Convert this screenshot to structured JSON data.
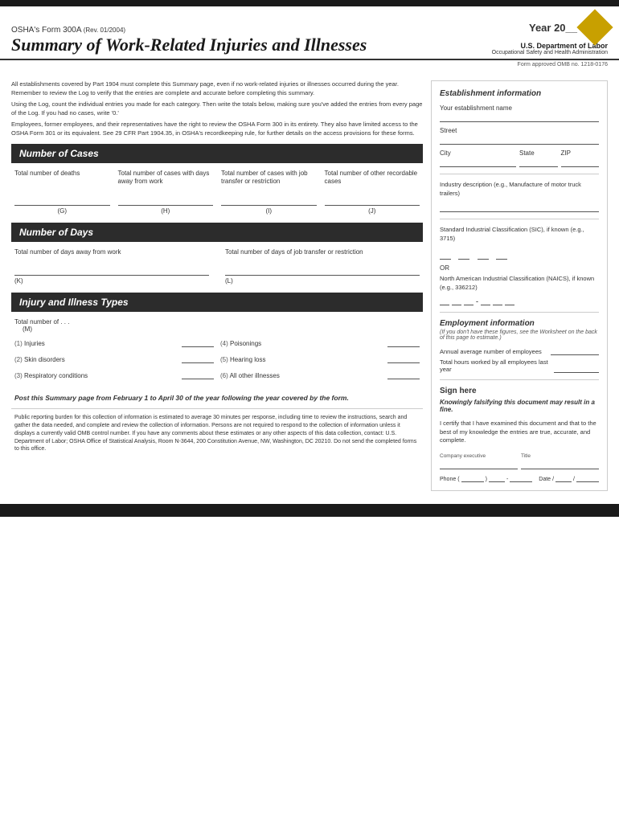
{
  "header": {
    "form_name": "OSHA's Form 300A",
    "form_rev": "(Rev. 01/2004)",
    "form_title": "Summary of Work-Related Injuries and Illnesses",
    "year_label": "Year 20",
    "year_blank": "__",
    "dept_name": "U.S. Department of Labor",
    "dept_sub": "Occupational Safety and Health Administration",
    "omb_text": "Form approved OMB no. 1218-0176"
  },
  "intro": {
    "para1": "All establishments covered by Part 1904 must complete this Summary page, even if no work-related injuries or illnesses occurred during the year. Remember to review the Log to verify that the entries are complete and accurate before completing this summary.",
    "para2": "Using the Log, count the individual entries you made for each category. Then write the totals below, making sure you've added the entries from every page of the Log. If you had no cases, write '0.'",
    "para3": "Employees, former employees, and their representatives have the right to review the OSHA Form 300 in its entirety. They also have limited access to the OSHA Form 301 or its equivalent. See 29 CFR Part 1904.35, in OSHA's recordkeeping rule, for further details on the access provisions for these forms."
  },
  "number_of_cases": {
    "section_title": "Number of Cases",
    "col1_label": "Total number of deaths",
    "col2_label": "Total number of cases with days away from work",
    "col3_label": "Total number of cases with job transfer or restriction",
    "col4_label": "Total number of other recordable cases",
    "code1": "(G)",
    "code2": "(H)",
    "code3": "(I)",
    "code4": "(J)"
  },
  "number_of_days": {
    "section_title": "Number of Days",
    "col1_label": "Total number of days away from work",
    "col2_label": "Total number of days of job transfer or restriction",
    "code1": "(K)",
    "code2": "(L)"
  },
  "injury_illness": {
    "section_title": "Injury and Illness Types",
    "total_label": "Total number of . . .",
    "code_m": "(M)",
    "items_left": [
      {
        "code": "(1)",
        "label": "Injuries"
      },
      {
        "code": "(2)",
        "label": "Skin disorders"
      },
      {
        "code": "(3)",
        "label": "Respiratory conditions"
      }
    ],
    "items_right": [
      {
        "code": "(4)",
        "label": "Poisonings"
      },
      {
        "code": "(5)",
        "label": "Hearing loss"
      },
      {
        "code": "(6)",
        "label": "All other illnesses"
      }
    ]
  },
  "post_notice": {
    "text": "Post this Summary page from February 1 to April 30 of the year following the year covered by the form."
  },
  "bottom_notice": {
    "text": "Public reporting burden for this collection of information is estimated to average 30 minutes per response, including time to review the instructions, search and gather the data needed, and complete and review the collection of information. Persons are not required to respond to the collection of information unless it displays a currently valid OMB control number. If you have any comments about these estimates or any other aspects of this data collection, contact: U.S. Department of Labor; OSHA Office of Statistical Analysis, Room N-3644, 200 Constitution Avenue, NW, Washington, DC 20210. Do not send the completed forms to this office."
  },
  "establishment_info": {
    "section_title": "Establishment information",
    "name_label": "Your establishment name",
    "street_label": "Street",
    "city_label": "City",
    "state_label": "State",
    "zip_label": "ZIP",
    "industry_label": "Industry description (e.g., Manufacture of motor truck trailers)",
    "sic_label": "Standard Industrial Classification (SIC), if known (e.g., 3715)",
    "or_text": "OR",
    "naics_label": "North American Industrial Classification (NAICS), if known (e.g., 336212)"
  },
  "employment_info": {
    "section_title": "Employment information",
    "sub_text": "(If you don't have these figures, see the Worksheet on the back of this page to estimate.)",
    "avg_employees_label": "Annual average number of employees",
    "total_hours_label": "Total hours worked by all employees last year"
  },
  "sign_here": {
    "section_title": "Sign here",
    "warning": "Knowingly falsifying this document may result in a fine.",
    "certify_text": "I certify that I have examined this document and that to the best of my knowledge the entries are true, accurate, and complete.",
    "exec_label": "Company executive",
    "title_label": "Title",
    "phone_label": "Phone",
    "date_label": "Date"
  }
}
